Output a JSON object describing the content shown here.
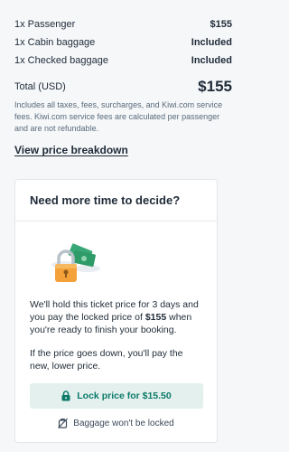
{
  "summary": {
    "rows": [
      {
        "label": "1x Passenger",
        "value": "$155"
      },
      {
        "label": "1x Cabin baggage",
        "value": "Included"
      },
      {
        "label": "1x Checked baggage",
        "value": "Included"
      }
    ],
    "total_label": "Total (USD)",
    "total_value": "$155",
    "fine_print": "Includes all taxes, fees, surcharges, and Kiwi.com service fees. Kiwi.com service fees are calculated per passenger and are not refundable.",
    "breakdown_link": "View price breakdown"
  },
  "lock_card": {
    "title": "Need more time to decide?",
    "para1_before": "We'll hold this ticket price for 3 days and you pay the locked price of ",
    "para1_price": "$155",
    "para1_after": " when you're ready to finish your booking.",
    "para2": "If the price goes down, you'll pay the new, lower price.",
    "button_label": "Lock price for $15.50",
    "baggage_note": "Baggage won't be locked"
  },
  "colors": {
    "accent_green": "#0c7a69",
    "button_bg": "#e3f0ee",
    "text_dark": "#1f2b38",
    "text_muted": "#5a6b7b"
  },
  "icons": {
    "lock_button_icon": "padlock-icon",
    "baggage_icon": "crossed-bag-icon",
    "illustration": "padlock-with-cash-illustration"
  }
}
